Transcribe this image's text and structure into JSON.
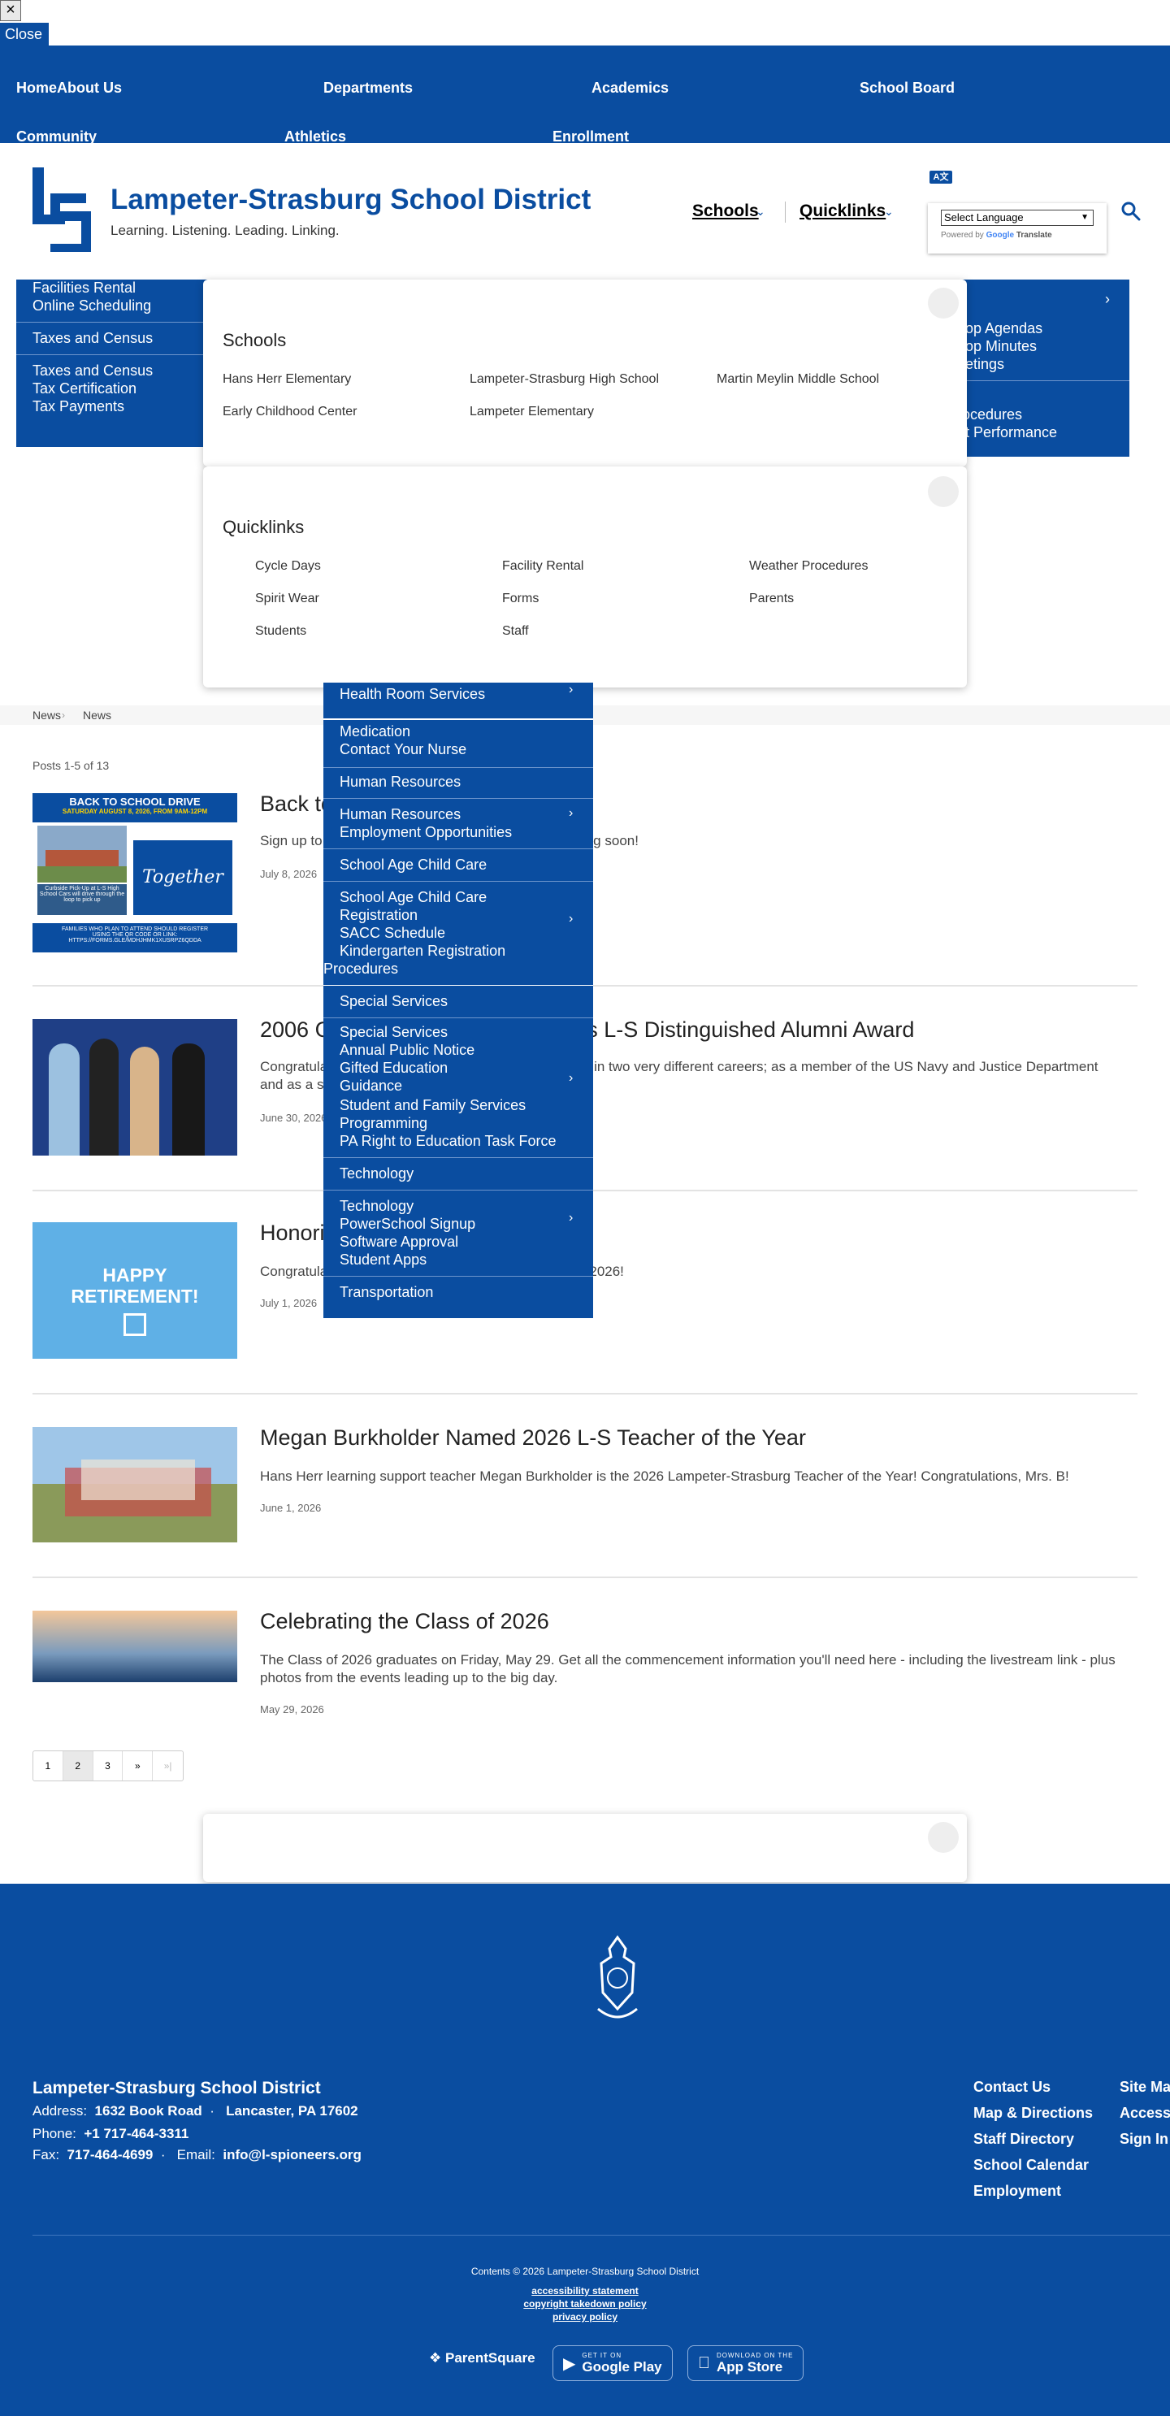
{
  "close_bar": {
    "x_label": "×",
    "close_label": "Close"
  },
  "top_nav": {
    "row1": [
      "HomeAbout Us",
      "Departments",
      "Academics",
      "School Board"
    ],
    "row2": [
      "Community",
      "Athletics",
      "Enrollment"
    ]
  },
  "header": {
    "title": "Lampeter-Strasburg School District",
    "tagline": "Learning. Listening. Leading. Linking.",
    "schools_label": "Schools",
    "quicklinks_label": "Quicklinks",
    "translate_icon": "A文",
    "language_select": "Select Language",
    "powered_by": "Powered by",
    "google": "Google",
    "translate": "Translate"
  },
  "left_dropdown": [
    "Facilities Rental",
    "Online Scheduling",
    "Taxes and Census",
    "Taxes and Census",
    "Tax Certification",
    "Tax Payments"
  ],
  "right_dropdown": [
    "s",
    "s",
    "hop Agendas",
    "hop Minutes",
    "eetings",
    "s",
    "rocedures",
    "nt Performance"
  ],
  "schools_popup": {
    "heading": "Schools",
    "links": [
      "Hans Herr Elementary",
      "Lampeter-Strasburg High School",
      "Martin Meylin Middle School",
      "Early Childhood Center",
      "Lampeter Elementary"
    ]
  },
  "quicklinks_popup": {
    "heading": "Quicklinks",
    "links": [
      "Cycle Days",
      "Facility Rental",
      "Weather Procedures",
      "Spirit Wear",
      "Forms",
      "Parents",
      "Students",
      "Staff"
    ]
  },
  "breadcrumb": [
    "News",
    "News"
  ],
  "posts_count": "Posts 1-5 of 13",
  "posts": [
    {
      "title": "Back to School Drive",
      "summary": "Sign up to donate to the back to school drive happening soon!",
      "date": "July 8, 2026",
      "image": {
        "header": "BACK TO SCHOOL DRIVE",
        "subheader": "SATURDAY AUGUST 8, 2026, FROM 9AM-12PM",
        "left_text": "Curbside Pick-Up at L-S High School Cars will drive through the loop to pick up",
        "right_text": "Together",
        "bottom_text": "FAMILIES WHO PLAN TO ATTEND SHOULD REGISTER USING THE QR CODE OR LINK:",
        "link": "HTTPS://FORMS.GLE/MDHJHMK1XUSRPZ6QDDA"
      }
    },
    {
      "title": "2006 Graduate Nate Fox Receives L-S Distinguished Alumni Award",
      "summary": "Congratulations to Nate Fox who has been successful in two very different careers; as a member of the US Navy and Justice Department and as a successful small business owner!",
      "date": "June 30, 2026"
    },
    {
      "title": "Honoring our 2026 Retirees",
      "summary": "Congratulations to all our L-S retirees for the Class of 2026!",
      "date": "July 1, 2026",
      "image": {
        "line1": "HAPPY",
        "line2": "RETIREMENT!"
      }
    },
    {
      "title": "Megan Burkholder Named 2026 L-S Teacher of the Year",
      "summary": "Hans Herr learning support teacher Megan Burkholder is the 2026 Lampeter-Strasburg Teacher of the Year! Congratulations, Mrs. B!",
      "date": "June 1, 2026"
    },
    {
      "title": "Celebrating the Class of 2026",
      "summary": "The Class of 2026 graduates on Friday, May 29. Get all the commencement information you'll need here - including the livestream link - plus photos from the events leading up to the big day.",
      "date": "May 29, 2026"
    }
  ],
  "dept_dropdown": {
    "items": [
      "Health Room Services",
      "Medication",
      "Contact Your Nurse",
      "Human Resources",
      "Human Resources",
      "Employment Opportunities",
      "School Age Child Care",
      "School Age Child Care",
      "Registration",
      "SACC Schedule",
      "Kindergarten Registration",
      "Procedures",
      "Special Services",
      "Special Services",
      "Annual Public Notice",
      "Gifted Education",
      "Guidance",
      "Student and Family Services",
      "Programming",
      "PA Right to Education Task Force",
      "Technology",
      "Technology",
      "PowerSchool Signup",
      "Software Approval",
      "Student Apps",
      "Transportation"
    ],
    "chevron": "›"
  },
  "pagination": {
    "pages": [
      "1",
      "2",
      "3",
      "»",
      "»|"
    ]
  },
  "footer": {
    "name": "Lampeter-Strasburg School District",
    "address_label": "Address:",
    "address_street": "1632 Book Road",
    "address_city": "Lancaster, PA 17602",
    "phone_label": "Phone:",
    "phone": "+1 717-464-3311",
    "fax_label": "Fax:",
    "fax": "717-464-4699",
    "email_label": "Email:",
    "email": "info@l-spioneers.org",
    "links_col1": [
      "Contact Us",
      "Map & Directions",
      "Staff Directory",
      "School Calendar",
      "Employment"
    ],
    "links_col2": [
      "Site Ma",
      "Accessi",
      "Sign In"
    ],
    "copyright": "Contents © 2026 Lampeter-Strasburg School District",
    "policies": [
      "accessibility statement",
      "copyright takedown policy",
      "privacy policy"
    ],
    "parentsquare": "ParentSquare",
    "google_play_small": "GET IT ON",
    "google_play": "Google Play",
    "app_store_small": "DOWNLOAD ON THE",
    "app_store": "App Store"
  },
  "colors": {
    "brand_blue": "#0a4da0",
    "text_dark": "#222222",
    "divider": "#e3e3e3"
  }
}
